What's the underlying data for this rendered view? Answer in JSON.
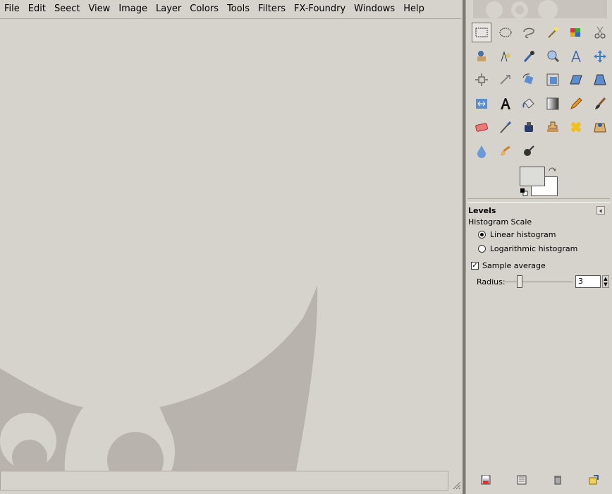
{
  "menubar": {
    "items": [
      "File",
      "Edit",
      "Seect",
      "View",
      "Image",
      "Layer",
      "Colors",
      "Tools",
      "Filters",
      "FX-Foundry",
      "Windows",
      "Help"
    ]
  },
  "statusbar": {
    "text": ""
  },
  "toolbox": {
    "tools": [
      "rect-select-icon",
      "ellipse-select-icon",
      "free-select-icon",
      "fuzzy-select-icon",
      "color-select-icon",
      "scissors-icon",
      "foreground-select-icon",
      "paths-icon",
      "color-picker-icon",
      "zoom-icon",
      "measure-icon",
      "move-icon",
      "align-icon",
      "crop-icon",
      "rotate-icon",
      "scale-icon",
      "shear-icon",
      "perspective-icon",
      "flip-icon",
      "text-icon",
      "bucket-fill-icon",
      "blend-icon",
      "pencil-icon",
      "paintbrush-icon",
      "eraser-icon",
      "airbrush-icon",
      "ink-icon",
      "clone-icon",
      "heal-icon",
      "perspective-clone-icon",
      "blur-icon",
      "smudge-icon",
      "dodge-burn-icon"
    ],
    "active_tool": "rect-select-icon",
    "colors": {
      "foreground": "#dcdcd8",
      "background": "#ffffff"
    }
  },
  "tool_options": {
    "title": "Levels",
    "histogram_scale_label": "Histogram Scale",
    "linear_label": "Linear histogram",
    "log_label": "Logarithmic histogram",
    "histogram_scale_selected": "linear",
    "sample_average_label": "Sample average",
    "sample_average_checked": true,
    "radius_label": "Radius:",
    "radius_value": "3",
    "radius_fraction": 0.22
  },
  "bottom_buttons": [
    "save-preset-icon",
    "restore-preset-icon",
    "delete-preset-icon",
    "reset-icon"
  ]
}
